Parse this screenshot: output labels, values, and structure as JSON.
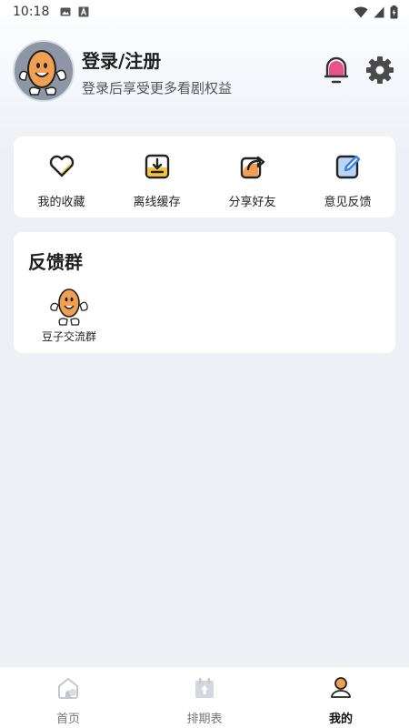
{
  "status_bar": {
    "time": "10:18"
  },
  "profile": {
    "title": "登录/注册",
    "subtitle": "登录后享受更多看剧权益"
  },
  "actions": [
    {
      "label": "我的收藏",
      "icon": "heart-icon"
    },
    {
      "label": "离线缓存",
      "icon": "download-icon"
    },
    {
      "label": "分享好友",
      "icon": "share-icon"
    },
    {
      "label": "意见反馈",
      "icon": "feedback-edit-icon"
    }
  ],
  "feedback_group": {
    "title": "反馈群",
    "items": [
      {
        "label": "豆子交流群",
        "icon": "bean-mascot-icon"
      }
    ]
  },
  "bottom_nav": [
    {
      "label": "首页",
      "icon": "home-icon",
      "active": false
    },
    {
      "label": "排期表",
      "icon": "calendar-icon",
      "active": false
    },
    {
      "label": "我的",
      "icon": "profile-icon",
      "active": true
    }
  ],
  "colors": {
    "accent_yellow": "#f6c343",
    "accent_orange": "#f0a050",
    "bell_pink": "#e7538a",
    "background": "#eef0f6"
  }
}
